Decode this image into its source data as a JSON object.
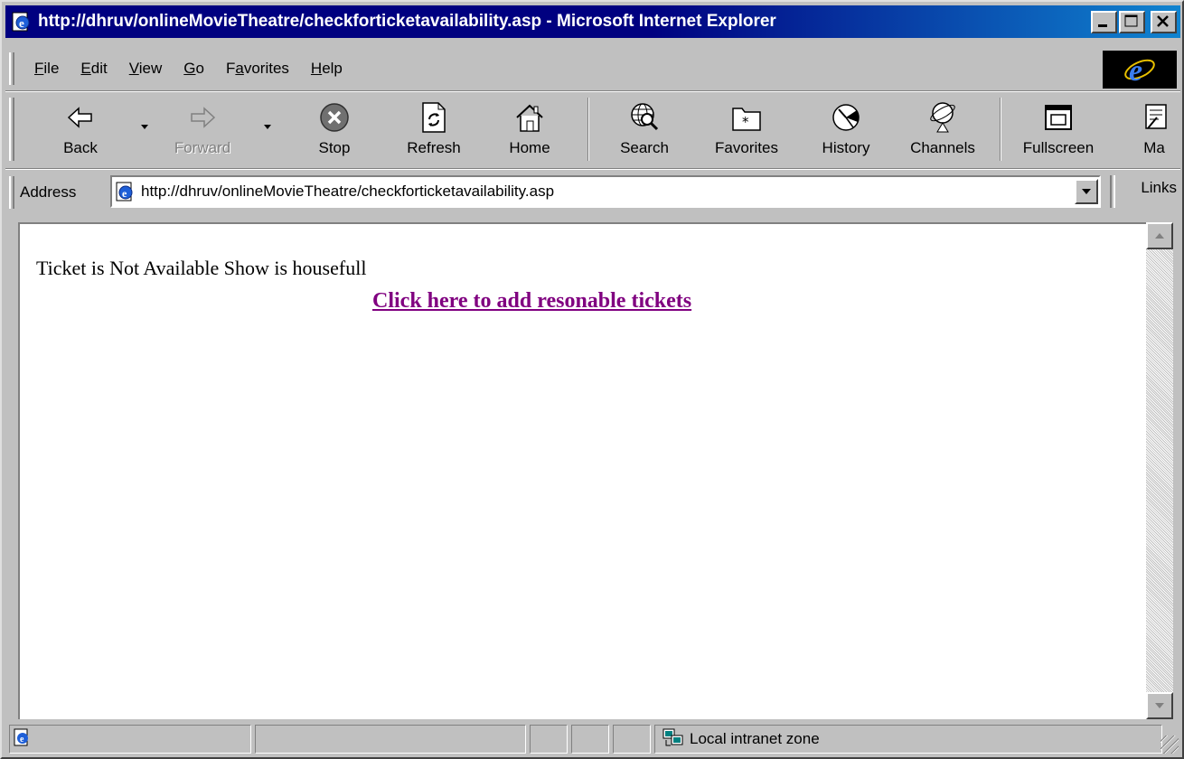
{
  "window": {
    "title": "http://dhruv/onlineMovieTheatre/checkforticketavailability.asp - Microsoft Internet Explorer"
  },
  "menu": {
    "items": [
      {
        "label": "File",
        "mnemonic": "F"
      },
      {
        "label": "Edit",
        "mnemonic": "E"
      },
      {
        "label": "View",
        "mnemonic": "V"
      },
      {
        "label": "Go",
        "mnemonic": "G"
      },
      {
        "label": "Favorites",
        "mnemonic": "a"
      },
      {
        "label": "Help",
        "mnemonic": "H"
      }
    ]
  },
  "toolbar": {
    "back": "Back",
    "forward": "Forward",
    "stop": "Stop",
    "refresh": "Refresh",
    "home": "Home",
    "search": "Search",
    "favorites": "Favorites",
    "history": "History",
    "channels": "Channels",
    "fullscreen": "Fullscreen",
    "mail": "Ma"
  },
  "address": {
    "label": "Address",
    "url": "http://dhruv/onlineMovieTheatre/checkforticketavailability.asp",
    "links_label": "Links"
  },
  "page": {
    "message": "Ticket is Not Available Show is housefull",
    "link_text": "Click here to add resonable tickets",
    "link_color": "#800080"
  },
  "status": {
    "zone": "Local intranet zone"
  },
  "colors": {
    "titlebar": "#000080",
    "chrome": "#c0c0c0"
  }
}
